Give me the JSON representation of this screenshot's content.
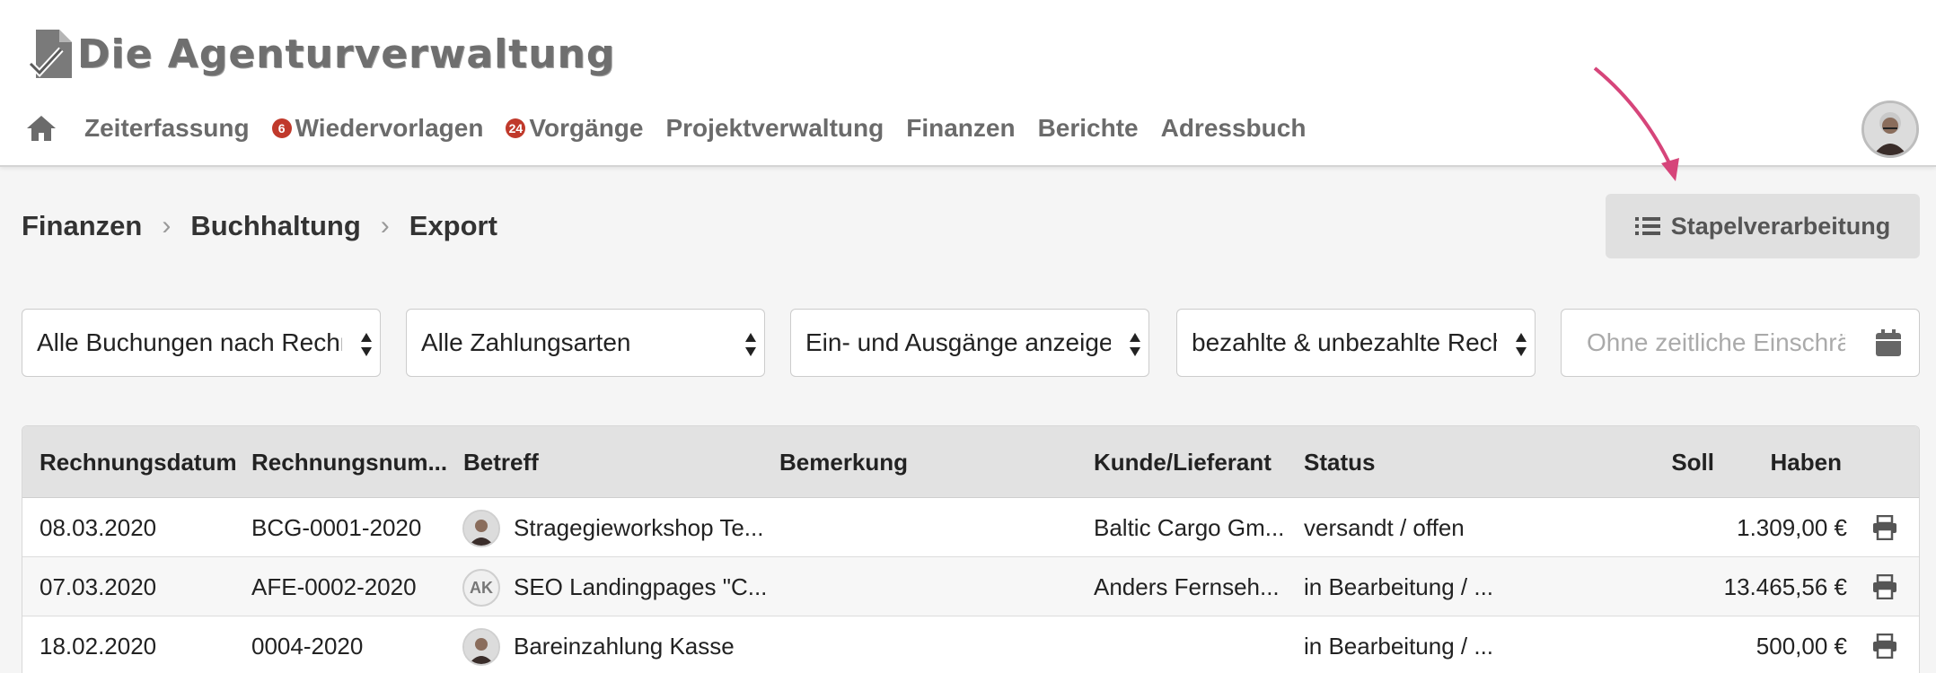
{
  "brand": {
    "title": "Die Agenturverwaltung"
  },
  "nav": {
    "items": [
      {
        "label": "Zeiterfassung",
        "badge": null
      },
      {
        "label": "Wiedervorlagen",
        "badge": "6"
      },
      {
        "label": "Vorgänge",
        "badge": "24"
      },
      {
        "label": "Projektverwaltung",
        "badge": null
      },
      {
        "label": "Finanzen",
        "badge": null
      },
      {
        "label": "Berichte",
        "badge": null
      },
      {
        "label": "Adressbuch",
        "badge": null
      }
    ]
  },
  "breadcrumb": [
    "Finanzen",
    "Buchhaltung",
    "Export"
  ],
  "batch_button": {
    "label": "Stapelverarbeitung"
  },
  "filters": {
    "booking": "Alle Buchungen nach Rechnungsdatum",
    "payment": "Alle Zahlungsarten",
    "direction": "Ein- und Ausgänge anzeigen",
    "paid": "bezahlte & unbezahlte Rechnungen",
    "date_placeholder": "Ohne zeitliche Einschränkung"
  },
  "table": {
    "headers": [
      "Rechnungsdatum",
      "Rechnungsnum...",
      "Betreff",
      "Bemerkung",
      "Kunde/Lieferant",
      "Status",
      "Soll",
      "Haben"
    ],
    "rows": [
      {
        "date": "08.03.2020",
        "number": "BCG-0001-2020",
        "avatar": "photo",
        "initials": "",
        "subject": "Stragegieworkshop Te...",
        "note": "",
        "customer": "Baltic Cargo Gm...",
        "status": "versandt / offen",
        "soll": "",
        "haben": "1.309,00 €"
      },
      {
        "date": "07.03.2020",
        "number": "AFE-0002-2020",
        "avatar": "initials",
        "initials": "AK",
        "subject": "SEO Landingpages \"C...",
        "note": "",
        "customer": "Anders Fernseh...",
        "status": "in Bearbeitung / ...",
        "soll": "",
        "haben": "13.465,56 €"
      },
      {
        "date": "18.02.2020",
        "number": "0004-2020",
        "avatar": "photo",
        "initials": "",
        "subject": "Bareinzahlung Kasse",
        "note": "",
        "customer": "",
        "status": "in Bearbeitung / ...",
        "soll": "",
        "haben": "500,00 €"
      }
    ]
  },
  "colors": {
    "badge": "#c0392b",
    "annotation_arrow": "#d6457a",
    "header_bg": "#e2e2e2"
  }
}
